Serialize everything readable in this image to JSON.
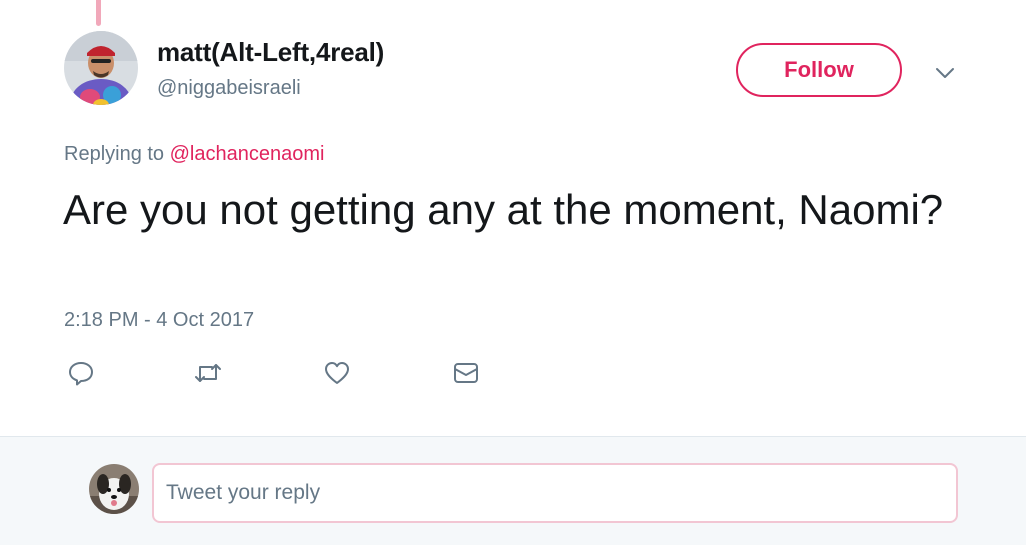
{
  "tweet": {
    "display_name": "matt(Alt-Left,4real)",
    "screen_name": "@niggabeisraeli",
    "follow_label": "Follow",
    "replying_prefix": "Replying to",
    "replying_to": "@lachancenaomi",
    "text": "Are you not getting any at the moment, Naomi?",
    "timestamp": "2:18 PM - 4 Oct 2017",
    "actions": [
      "reply-icon",
      "retweet-icon",
      "like-icon",
      "direct-message-icon"
    ]
  },
  "reply_box": {
    "placeholder": "Tweet your reply"
  },
  "colors": {
    "accent": "#e0245e",
    "text_primary": "#14171a",
    "text_secondary": "#657786",
    "thread_line": "#f1a8ba",
    "reply_area_bg": "#f5f8fa"
  }
}
